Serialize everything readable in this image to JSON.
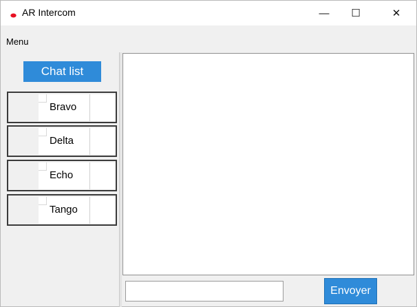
{
  "window": {
    "title": "AR Intercom",
    "controls": {
      "minimize": "—",
      "maximize": "☐",
      "close": "✕"
    }
  },
  "menubar": {
    "items": [
      {
        "label": "Menu"
      }
    ]
  },
  "sidebar": {
    "header_label": "Chat list",
    "items": [
      {
        "label": "Bravo"
      },
      {
        "label": "Delta"
      },
      {
        "label": "Echo"
      },
      {
        "label": "Tango"
      }
    ]
  },
  "composer": {
    "input_value": "",
    "input_placeholder": "",
    "send_label": "Envoyer"
  },
  "colors": {
    "accent": "#2f8bd9",
    "app_icon": "#e81123",
    "background": "#f0f0f0"
  },
  "icons": {
    "app": "app-icon",
    "minimize": "minimize-icon",
    "maximize": "maximize-icon",
    "close": "close-icon"
  }
}
